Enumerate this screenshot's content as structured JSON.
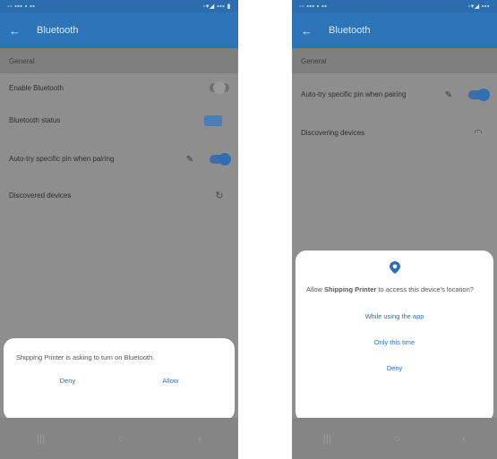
{
  "left": {
    "status_time": "",
    "app_title": "Bluetooth",
    "section_general": "General",
    "enable_bluetooth": "Enable Bluetooth",
    "bluetooth_status": "Bluetooth status",
    "bluetooth_status_sub": "",
    "ble_button": "",
    "auto_pairing": "Auto-try specific pin when pairing",
    "auto_pairing_sub": "",
    "discovered_devices": "Discovered devices",
    "dialog_message": "Shipping Printer is asking to turn on Bluetooth.",
    "deny": "Deny",
    "allow": "Allow"
  },
  "right": {
    "status_time": "",
    "app_title": "Bluetooth",
    "section_general": "General",
    "auto_pairing": "Auto-try specific pin when pairing",
    "auto_pairing_sub": "",
    "discovering_devices": "Discovering devices",
    "dialog_prefix": "Allow ",
    "dialog_app": "Shipping Printer",
    "dialog_suffix": " to access this device's location?",
    "while_using": "While using the app",
    "only_this_time": "Only this time",
    "deny": "Deny"
  },
  "icons": {
    "back": "arrow-back",
    "pencil": "pencil",
    "refresh": "refresh",
    "spinner": "spinner",
    "location": "location-pin"
  },
  "colors": {
    "app_bar": "#2e74b8",
    "accent": "#2d6fb5",
    "overlay": "#8e8e8e"
  }
}
